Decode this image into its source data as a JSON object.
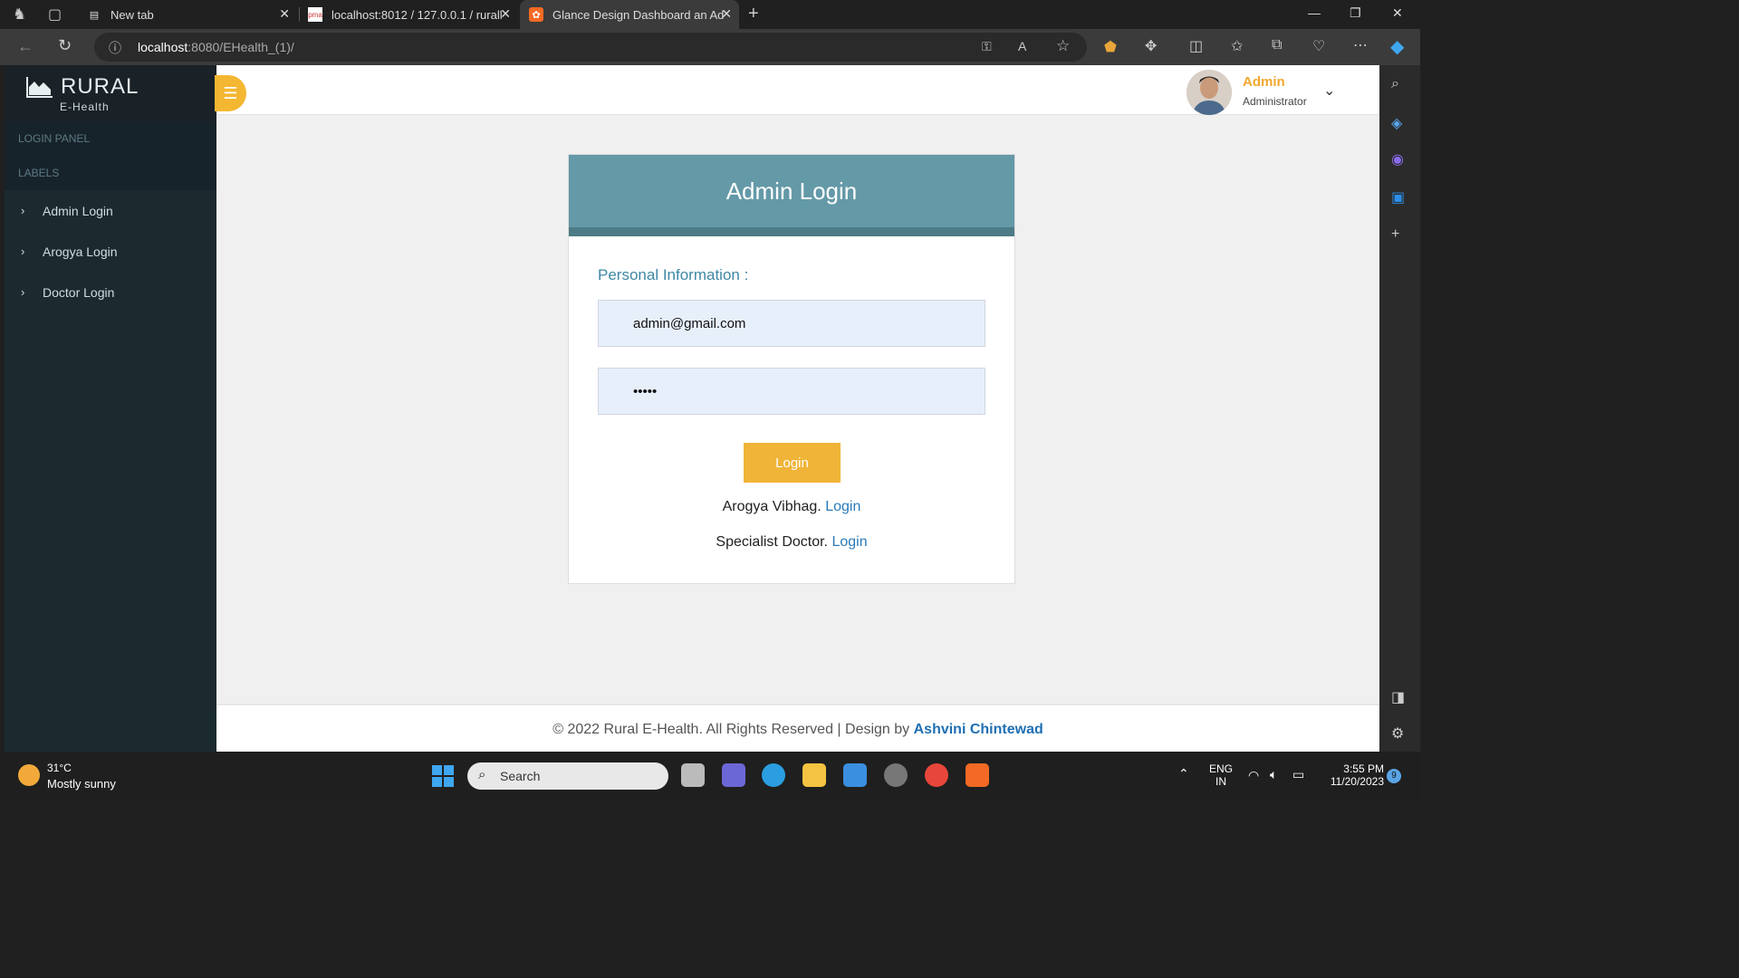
{
  "browser": {
    "tabs": [
      {
        "title": "New tab"
      },
      {
        "title": "localhost:8012 / 127.0.0.1 / rurall"
      },
      {
        "title": "Glance Design Dashboard an Ad"
      }
    ],
    "address_host": "localhost",
    "address_rest": ":8080/EHealth_(1)/"
  },
  "sidebar": {
    "brand_name": "RURAL",
    "brand_sub": "E-Health",
    "headers": [
      "LOGIN PANEL",
      "LABELS"
    ],
    "items": [
      {
        "label": "Admin Login"
      },
      {
        "label": "Arogya Login"
      },
      {
        "label": "Doctor Login"
      }
    ]
  },
  "user": {
    "name": "Admin",
    "role": "Administrator"
  },
  "login_card": {
    "title": "Admin Login",
    "section_label": "Personal Information :",
    "email_value": "admin@gmail.com",
    "password_value": "•••••",
    "button_label": "Login",
    "link1_prefix": "Arogya Vibhag.",
    "link1_text": "Login",
    "link2_prefix": "Specialist Doctor.",
    "link2_text": "Login"
  },
  "footer": {
    "text": "© 2022 Rural E-Health. All Rights Reserved | Design by",
    "author": "Ashvini Chintewad"
  },
  "taskbar": {
    "temp": "31°C",
    "weather": "Mostly sunny",
    "search_placeholder": "Search",
    "lang_top": "ENG",
    "lang_bottom": "IN",
    "time": "3:55 PM",
    "date": "11/20/2023",
    "notification_count": "9"
  },
  "colors": {
    "accent": "#f4b732",
    "header_blue": "#6499a8",
    "sidebar_bg": "#1b2a2f",
    "link_blue": "#2a7ab8"
  }
}
